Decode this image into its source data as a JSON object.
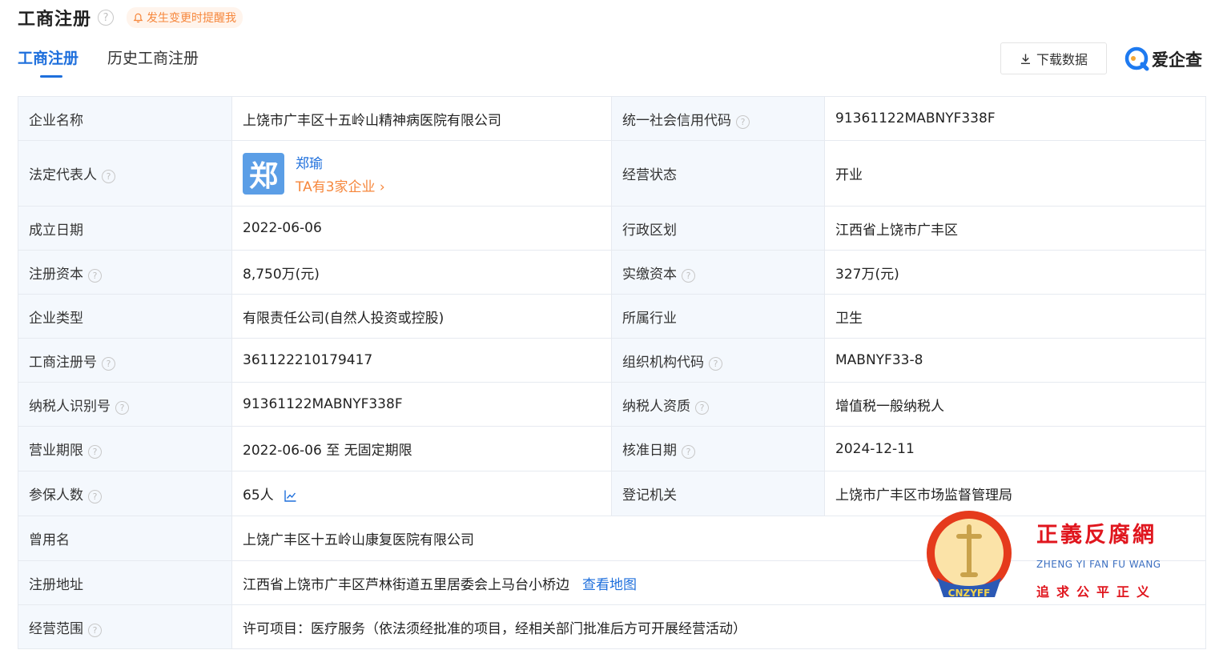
{
  "header": {
    "title": "工商注册",
    "help_glyph": "?",
    "remind_label": "发生变更时提醒我"
  },
  "tabs": [
    {
      "label": "工商注册",
      "active": true
    },
    {
      "label": "历史工商注册",
      "active": false
    }
  ],
  "toolbar": {
    "download_label": "下载数据",
    "brand_name": "爱企查"
  },
  "rows": {
    "r1": {
      "k1": "企业名称",
      "v1": "上饶市广丰区十五岭山精神病医院有限公司",
      "k2": "统一社会信用代码",
      "v2": "91361122MABNYF338F"
    },
    "r2": {
      "k1": "法定代表人",
      "avatar_char": "郑",
      "rep_name": "郑瑜",
      "rep_count": "TA有3家企业 ›",
      "k2": "经营状态",
      "v2": "开业"
    },
    "r3": {
      "k1": "成立日期",
      "v1": "2022-06-06",
      "k2": "行政区划",
      "v2": "江西省上饶市广丰区"
    },
    "r4": {
      "k1": "注册资本",
      "v1": "8,750万(元)",
      "k2": "实缴资本",
      "v2": "327万(元)"
    },
    "r5": {
      "k1": "企业类型",
      "v1": "有限责任公司(自然人投资或控股)",
      "k2": "所属行业",
      "v2": "卫生"
    },
    "r6": {
      "k1": "工商注册号",
      "v1": "361122210179417",
      "k2": "组织机构代码",
      "v2": "MABNYF33-8"
    },
    "r7": {
      "k1": "纳税人识别号",
      "v1": "91361122MABNYF338F",
      "k2": "纳税人资质",
      "v2": "增值税一般纳税人"
    },
    "r8": {
      "k1": "营业期限",
      "v1": "2022-06-06 至 无固定期限",
      "k2": "核准日期",
      "v2": "2024-12-11"
    },
    "r9": {
      "k1": "参保人数",
      "v1": "65人",
      "k2": "登记机关",
      "v2": "上饶市广丰区市场监督管理局"
    },
    "r10": {
      "k1": "曾用名",
      "v1": "上饶广丰区十五岭山康复医院有限公司"
    },
    "r11": {
      "k1": "注册地址",
      "v1": "江西省上饶市广丰区芦林街道五里居委会上马台小桥边",
      "map_link": "查看地图"
    },
    "r12": {
      "k1": "经营范围",
      "v1": "许可项目：医疗服务（依法须经批准的项目，经相关部门批准后方可开展经营活动）"
    }
  },
  "watermark": {
    "title": "正義反腐網",
    "pinyin": "ZHENG YI FAN FU WANG",
    "slogan": "追求公平正义",
    "emblem_text": "CNZYFF"
  },
  "colors": {
    "accent": "#1e6fdc",
    "orange": "#f6873c",
    "label_bg": "#f4f8fd",
    "border": "#e6eaf0",
    "watermark_red": "#e0161e"
  }
}
